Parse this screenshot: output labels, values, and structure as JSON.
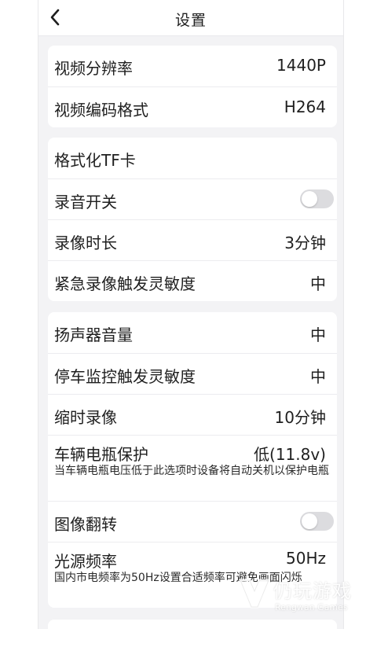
{
  "header": {
    "title": "设置"
  },
  "groups": [
    [
      {
        "label": "视频分辨率",
        "value": "1440P"
      },
      {
        "label": "视频编码格式",
        "value": "H264"
      }
    ],
    [
      {
        "label": "格式化TF卡"
      },
      {
        "label": "录音开关",
        "toggle": false
      },
      {
        "label": "录像时长",
        "value": "3分钟"
      },
      {
        "label": "紧急录像触发灵敏度",
        "value": "中"
      }
    ],
    [
      {
        "label": "扬声器音量",
        "value": "中"
      },
      {
        "label": "停车监控触发灵敏度",
        "value": "中"
      },
      {
        "label": "缩时录像",
        "value": "10分钟"
      },
      {
        "label": "车辆电瓶保护",
        "value": "低(11.8v)",
        "desc": "当车辆电瓶电压低于此选项时设备将自动关机以保护电瓶"
      },
      {
        "label": "图像翻转",
        "toggle": false
      },
      {
        "label": "光源频率",
        "value": "50Hz",
        "desc": "国内市电频率为50Hz设置合适频率可避免画面闪烁"
      }
    ]
  ],
  "watermark": {
    "brand": "仍玩游戏",
    "sub": "Rengwan Games"
  },
  "colors": {
    "background": "#f3f3f5",
    "card": "#ffffff",
    "toggle_off": "#dcdcdf"
  }
}
